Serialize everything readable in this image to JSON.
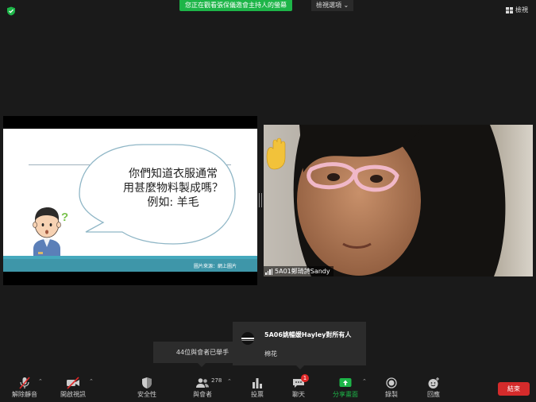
{
  "top_bar": {
    "share_banner": "您正在觀看張保儀邀會主持人的螢幕",
    "view_options": "檢視選項",
    "view_toggle": "檢視"
  },
  "shared_slide": {
    "bubble_lines": [
      "你們知道衣服通常",
      "用甚麼物料製成嗎？",
      "例如: 羊毛"
    ],
    "footer_credit": "圖片來源：網上圖片"
  },
  "video": {
    "participant_name": "5A01鄭琦詩Sandy"
  },
  "popups": {
    "raise_hand": "44位與會者已舉手",
    "chat_sender": "5A06姚暢媛Hayley對所有人",
    "chat_message": "棉花"
  },
  "toolbar": {
    "unmute": "解除靜音",
    "start_video": "開啟視訊",
    "security": "安全性",
    "participants": "與會者",
    "participants_count": "278",
    "polls": "投票",
    "chat": "聊天",
    "chat_badge": "1",
    "share_screen": "分享畫面",
    "record": "錄製",
    "reactions": "回應",
    "end": "結束"
  },
  "colors": {
    "accent_green": "#1db548",
    "end_red": "#d42b2b",
    "slide_teal": "#3e96a9"
  }
}
